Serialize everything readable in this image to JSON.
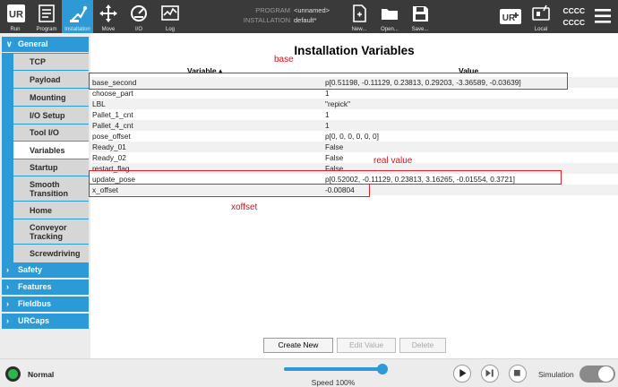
{
  "topbar": {
    "tabs": [
      {
        "label": "Run",
        "icon": "run-icon"
      },
      {
        "label": "Program",
        "icon": "program-icon"
      },
      {
        "label": "Installation",
        "icon": "installation-icon",
        "active": true
      },
      {
        "label": "Move",
        "icon": "move-icon"
      },
      {
        "label": "I/O",
        "icon": "io-icon"
      },
      {
        "label": "Log",
        "icon": "log-icon"
      }
    ],
    "program_key": "PROGRAM",
    "program_value": "<unnamed>",
    "installation_key": "INSTALLATION",
    "installation_value": "default*",
    "file_buttons": [
      {
        "label": "New...",
        "icon": "new-file-icon"
      },
      {
        "label": "Open...",
        "icon": "open-folder-icon"
      },
      {
        "label": "Save...",
        "icon": "save-icon"
      }
    ],
    "local_label": "Local",
    "cccc_1": "CCCC",
    "cccc_2": "CCCC"
  },
  "sidebar": {
    "general": "General",
    "general_items": [
      "TCP",
      "Payload",
      "Mounting",
      "I/O Setup",
      "Tool I/O",
      "Variables",
      "Startup",
      "Smooth Transition",
      "Home",
      "Conveyor Tracking",
      "Screwdriving"
    ],
    "active_item": "Variables",
    "other_categories": [
      "Safety",
      "Features",
      "Fieldbus",
      "URCaps"
    ]
  },
  "main": {
    "title": "Installation Variables",
    "col_variable": "Variable ▴",
    "col_value": "Value",
    "rows": [
      {
        "name": "base_second",
        "value": "p[0.51198, -0.11129, 0.23813, 0.29203, -3.36589, -0.03639]"
      },
      {
        "name": "choose_part",
        "value": "1"
      },
      {
        "name": "LBL",
        "value": "\"repick\""
      },
      {
        "name": "Pallet_1_cnt",
        "value": "1"
      },
      {
        "name": "Pallet_4_cnt",
        "value": "1"
      },
      {
        "name": "pose_offset",
        "value": "p[0, 0, 0, 0, 0, 0]"
      },
      {
        "name": "Ready_01",
        "value": "False"
      },
      {
        "name": "Ready_02",
        "value": "False"
      },
      {
        "name": "restart_flag",
        "value": "False"
      },
      {
        "name": "update_pose",
        "value": "p[0.52002, -0.11129, 0.23813, 3.16265, -0.01554, 0.3721]"
      },
      {
        "name": "x_offset",
        "value": "-0.00804"
      }
    ],
    "annotations": {
      "base": "base",
      "real_value": "real value",
      "xoffset": "xoffset"
    },
    "buttons": {
      "create_new": "Create New",
      "edit_value": "Edit Value",
      "delete": "Delete"
    }
  },
  "bottombar": {
    "status": "Normal",
    "speed_label": "Speed 100%",
    "speed_percent": 100,
    "simulation_label": "Simulation",
    "colors": {
      "accent": "#2b9ad6",
      "status_ok": "#2fb54a",
      "annotation": "#e0202a"
    }
  }
}
